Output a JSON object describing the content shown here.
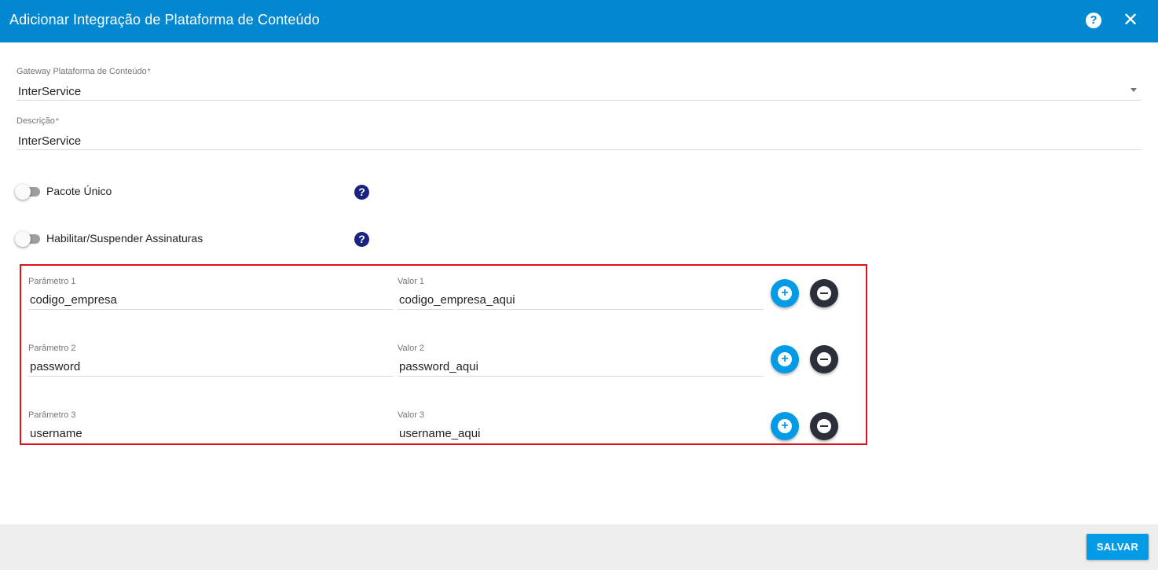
{
  "dialog": {
    "title": "Adicionar Integração de Plataforma de Conteúdo",
    "help_icon": "help-circle-icon",
    "close_icon": "close-icon"
  },
  "form": {
    "gateway": {
      "label": "Gateway Plataforma de Conteúdo",
      "required_mark": "*",
      "value": "InterService"
    },
    "descricao": {
      "label": "Descrição",
      "required_mark": "*",
      "value": "InterService"
    },
    "toggles": [
      {
        "label": "Pacote Único",
        "enabled": false
      },
      {
        "label": "Habilitar/Suspender Assinaturas",
        "enabled": false
      }
    ],
    "parameters": [
      {
        "param_label": "Parâmetro 1",
        "param_value": "codigo_empresa",
        "valor_label": "Valor 1",
        "valor_value": "codigo_empresa_aqui"
      },
      {
        "param_label": "Parâmetro 2",
        "param_value": "password",
        "valor_label": "Valor 2",
        "valor_value": "password_aqui"
      },
      {
        "param_label": "Parâmetro 3",
        "param_value": "username",
        "valor_label": "Valor 3",
        "valor_value": "username_aqui"
      }
    ]
  },
  "footer": {
    "save_label": "SALVAR"
  },
  "colors": {
    "header": "#0288d1",
    "add_button": "#039be5",
    "remove_button": "#2b2f3a",
    "help_icon": "#1a237e",
    "highlight_box": "#e3101a",
    "footer": "#eeeeee"
  }
}
